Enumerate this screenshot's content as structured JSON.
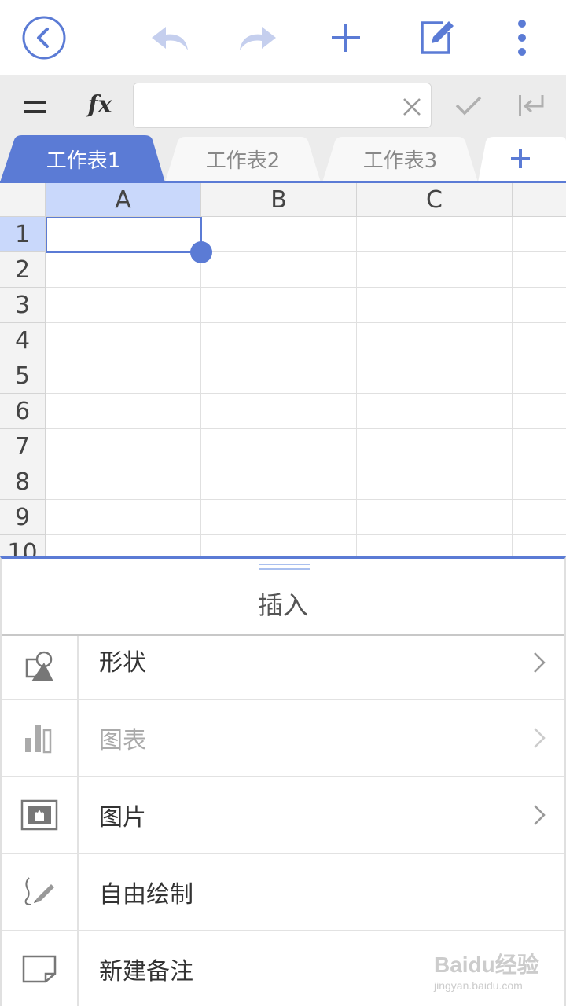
{
  "formula_bar": {
    "equals_label": "=",
    "fx_label": "fx",
    "input_value": "",
    "input_placeholder": ""
  },
  "sheet_tabs": [
    {
      "label": "工作表1",
      "active": true
    },
    {
      "label": "工作表2",
      "active": false
    },
    {
      "label": "工作表3",
      "active": false
    }
  ],
  "add_sheet_label": "+",
  "grid": {
    "columns": [
      "A",
      "B",
      "C"
    ],
    "rows": [
      "1",
      "2",
      "3",
      "4",
      "5",
      "6",
      "7",
      "8",
      "9",
      "10"
    ],
    "selected_cell": "A1",
    "selected_cell_value": ""
  },
  "insert_panel": {
    "title": "插入",
    "items": [
      {
        "label": "形状",
        "icon": "shape-icon",
        "has_submenu": true,
        "enabled": true
      },
      {
        "label": "图表",
        "icon": "chart-icon",
        "has_submenu": true,
        "enabled": false
      },
      {
        "label": "图片",
        "icon": "picture-icon",
        "has_submenu": true,
        "enabled": true
      },
      {
        "label": "自由绘制",
        "icon": "freehand-draw-icon",
        "has_submenu": false,
        "enabled": true
      },
      {
        "label": "新建备注",
        "icon": "note-icon",
        "has_submenu": false,
        "enabled": true
      }
    ]
  },
  "watermark": {
    "logo": "Baidu经验",
    "url": "jingyan.baidu.com"
  },
  "colors": {
    "accent": "#5b7bd5",
    "accent_light": "#c9d8fb",
    "toolbar_bg": "#ffffff",
    "formula_bg": "#ececec",
    "disabled": "#c5cfee"
  }
}
